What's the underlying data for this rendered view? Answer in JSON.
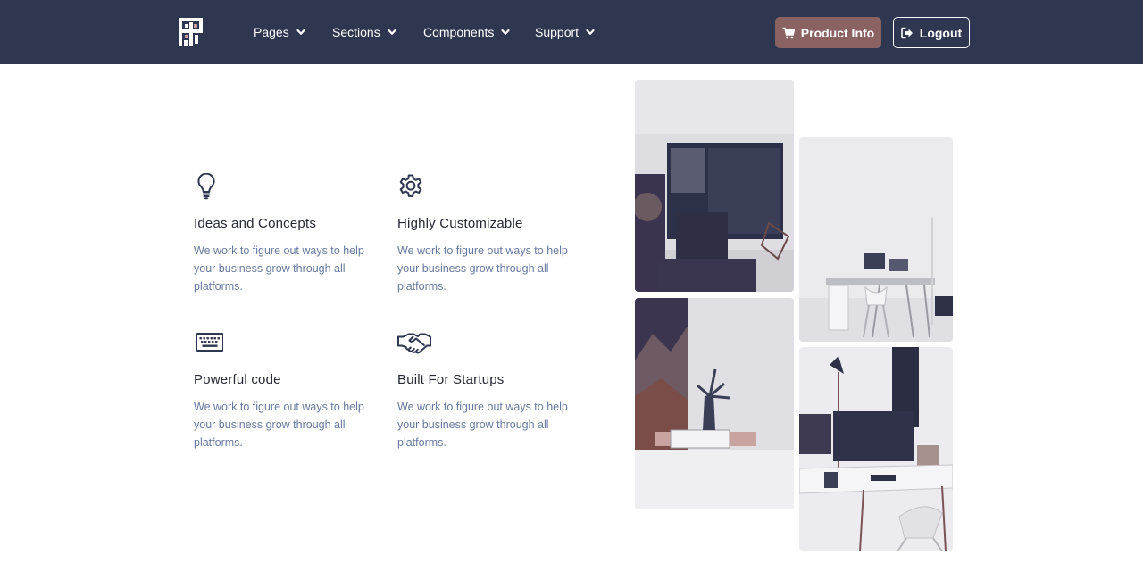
{
  "navbar": {
    "logo_icon": "pixel-logo-icon",
    "items": [
      {
        "label": "Pages",
        "icon": "chevron-down-icon"
      },
      {
        "label": "Sections",
        "icon": "chevron-down-icon"
      },
      {
        "label": "Components",
        "icon": "chevron-down-icon"
      },
      {
        "label": "Support",
        "icon": "chevron-down-icon"
      }
    ],
    "product_button": {
      "label": "Product Info",
      "icon": "cart-icon"
    },
    "logout_button": {
      "label": "Logout",
      "icon": "sign-out-icon"
    }
  },
  "features": [
    {
      "icon": "lightbulb-icon",
      "title": "Ideas and Concepts",
      "text": "We work to figure out ways to help your business grow through all platforms."
    },
    {
      "icon": "gear-icon",
      "title": "Highly Customizable",
      "text": "We work to figure out ways to help your business grow through all platforms."
    },
    {
      "icon": "keyboard-icon",
      "title": "Powerful code",
      "text": "We work to figure out ways to help your business grow through all platforms."
    },
    {
      "icon": "handshake-icon",
      "title": "Built For Startups",
      "text": "We work to figure out ways to help your business grow through all platforms."
    }
  ],
  "gallery": [
    "photo-monitor-desk",
    "photo-white-office",
    "photo-plant-shelf",
    "photo-lamp-desk"
  ],
  "colors": {
    "navbar_bg": "#2e3650",
    "accent": "#8a6262",
    "heading": "#262833",
    "body_text": "#66799e"
  }
}
